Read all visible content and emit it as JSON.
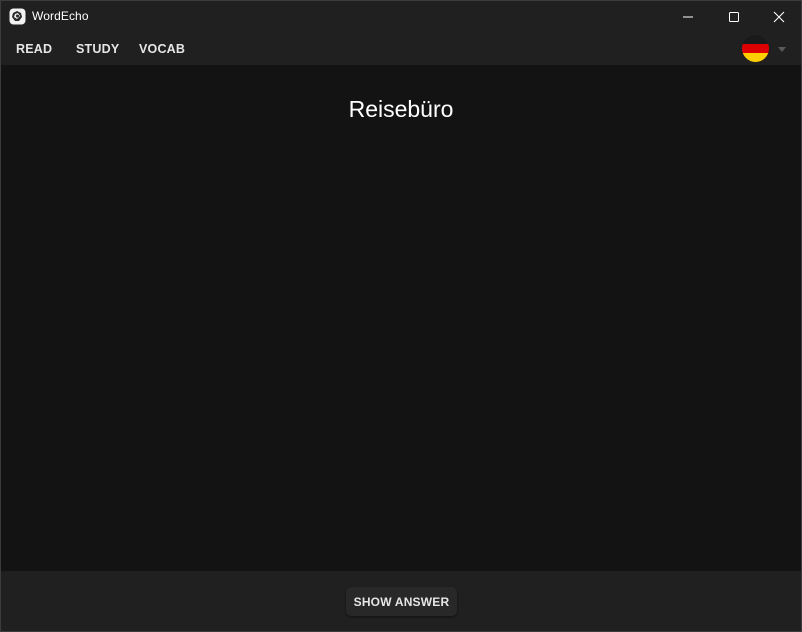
{
  "window": {
    "title": "WordEcho",
    "icons": [
      "app-icon",
      "minimize-icon",
      "maximize-icon",
      "close-icon"
    ]
  },
  "nav": {
    "tabs": [
      {
        "label": "READ"
      },
      {
        "label": "STUDY"
      },
      {
        "label": "VOCAB"
      }
    ],
    "language": {
      "icon": "germany-flag-icon",
      "dropdown_icon": "chevron-down-icon"
    }
  },
  "card": {
    "word": "Reisebüro"
  },
  "footer": {
    "show_answer_label": "SHOW ANSWER"
  },
  "colors": {
    "titlebar_bg": "#202020",
    "content_bg": "#131313",
    "button_bg": "#282828",
    "text": "#e6e6e6"
  }
}
